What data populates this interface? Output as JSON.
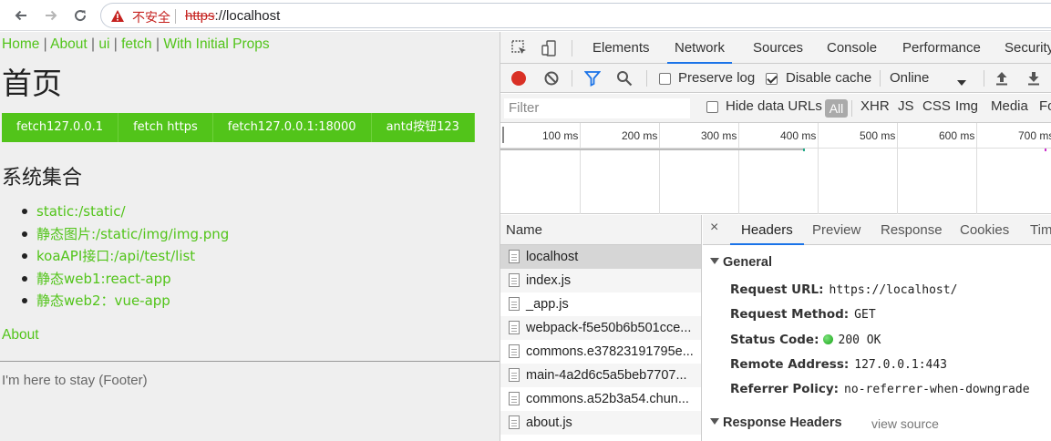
{
  "browser": {
    "insecure_label": "不安全",
    "url_scheme": "https",
    "url_rest": "://localhost"
  },
  "page": {
    "nav": [
      "Home",
      "About",
      "ui",
      "fetch",
      "With Initial Props"
    ],
    "nav_separator": "|",
    "title": "首页",
    "buttons": [
      "fetch127.0.0.1",
      "fetch https",
      "fetch127.0.0.1:18000",
      "antd按钮123"
    ],
    "section_title": "系统集合",
    "links": [
      "static:/static/",
      "静态图片:/static/img/img.png",
      "koaAPI接口:/api/test/list",
      "静态web1:react-app",
      "静态web2：vue-app"
    ],
    "about_link": "About",
    "footer": "I'm here to stay (Footer)"
  },
  "devtools": {
    "tabs": [
      "Elements",
      "Network",
      "Sources",
      "Console",
      "Performance",
      "Security"
    ],
    "active_tab": "Network",
    "preserve_log": "Preserve log",
    "disable_cache": "Disable cache",
    "disable_cache_checked": true,
    "throttle": "Online",
    "filter_placeholder": "Filter",
    "hide_data_urls": "Hide data URLs",
    "type_filters": [
      "All",
      "XHR",
      "JS",
      "CSS",
      "Img",
      "Media",
      "Fo"
    ],
    "timeline_ticks": [
      "100 ms",
      "200 ms",
      "300 ms",
      "400 ms",
      "500 ms",
      "600 ms",
      "700 ms"
    ],
    "name_header": "Name",
    "requests": [
      "localhost",
      "index.js",
      "_app.js",
      "webpack-f5e50b6b501cce...",
      "commons.e37823191795e...",
      "main-4a2d6c5a5beb7707...",
      "commons.a52b3a54.chun...",
      "about.js"
    ],
    "detail_close": "×",
    "detail_tabs": [
      "Headers",
      "Preview",
      "Response",
      "Cookies",
      "Tim"
    ],
    "general_title": "General",
    "general": [
      {
        "key": "Request URL:",
        "value": "https://localhost/"
      },
      {
        "key": "Request Method:",
        "value": "GET"
      },
      {
        "key": "Status Code:",
        "value": "200 OK"
      },
      {
        "key": "Remote Address:",
        "value": "127.0.0.1:443"
      },
      {
        "key": "Referrer Policy:",
        "value": "no-referrer-when-downgrade"
      }
    ],
    "response_headers_title": "Response Headers",
    "view_source": "view source"
  }
}
